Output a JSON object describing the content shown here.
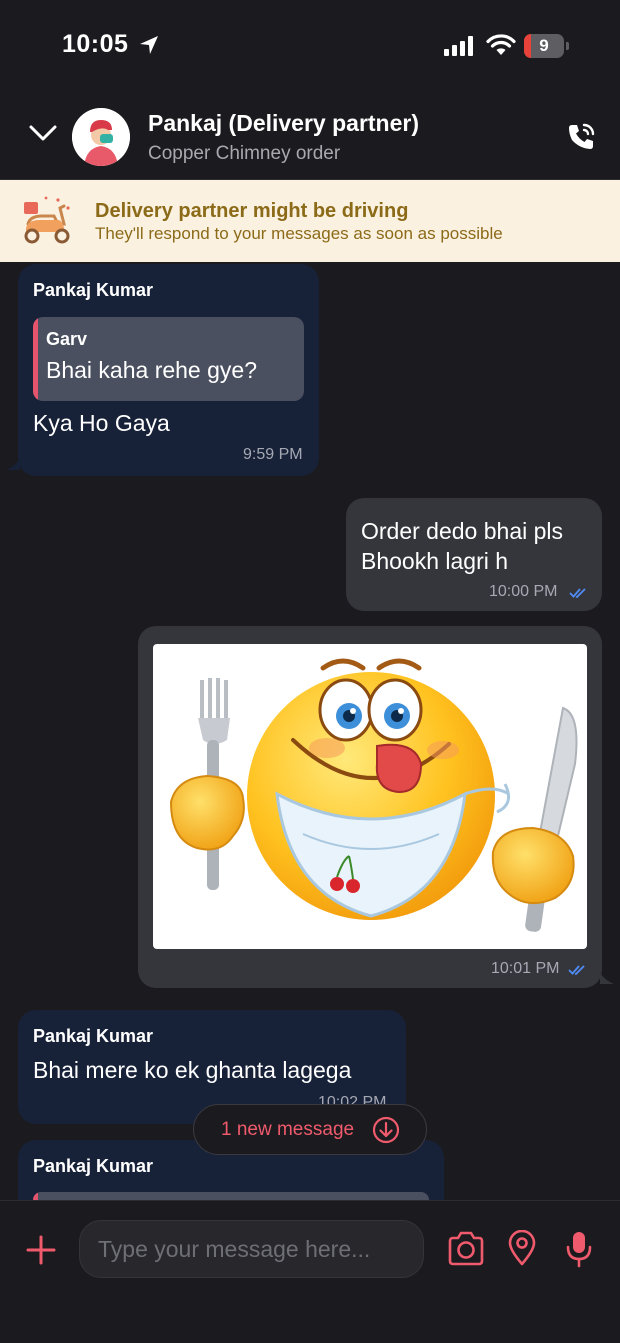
{
  "status_bar": {
    "time": "10:05",
    "battery": "9"
  },
  "header": {
    "contact_name": "Pankaj (Delivery partner)",
    "subtitle": "Copper Chimney order"
  },
  "banner": {
    "title": "Delivery partner might be driving",
    "subtitle": "They'll respond to your messages as soon as possible"
  },
  "messages": [
    {
      "direction": "incoming",
      "sender": "Pankaj Kumar",
      "quote": {
        "name": "Garv",
        "text": "Bhai kaha rehe gye?"
      },
      "text": "Kya Ho Gaya",
      "time": "9:59 PM"
    },
    {
      "direction": "outgoing",
      "text_lines": [
        "Order dedo bhai pls",
        "Bhookh lagri h"
      ],
      "time": "10:00 PM"
    },
    {
      "direction": "outgoing",
      "image": "hungry-emoji-with-fork-and-knife",
      "time": "10:01 PM"
    },
    {
      "direction": "incoming",
      "sender": "Pankaj Kumar",
      "text": "Bhai mere ko ek ghanta lagega",
      "time": "10:02 PM"
    },
    {
      "direction": "incoming",
      "sender": "Pankaj Kumar"
    }
  ],
  "new_message_pill": {
    "label": "1 new message"
  },
  "composer": {
    "placeholder": "Type your message here..."
  },
  "colors": {
    "background": "#1b1b1f",
    "incoming_bubble": "#172138",
    "outgoing_bubble": "#35363c",
    "accent": "#ef5a6c",
    "banner_bg": "#fbf1e1",
    "banner_text": "#8b6a18",
    "read_tick": "#4f8cf5"
  },
  "icons": [
    "location-arrow-icon",
    "signal-icon",
    "wifi-icon",
    "battery-icon",
    "chevron-down-icon",
    "call-icon",
    "scooter-icon",
    "read-tick-icon",
    "arrow-down-circle-icon",
    "plus-icon",
    "camera-icon",
    "location-pin-icon",
    "mic-icon"
  ]
}
